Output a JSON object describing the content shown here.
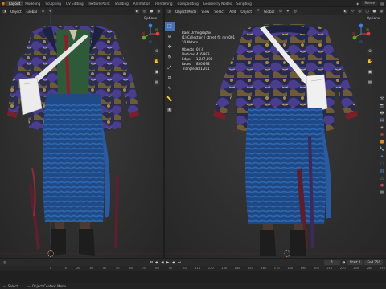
{
  "topbar": {
    "tabs": [
      "Layout",
      "Modeling",
      "Sculpting",
      "UV Editing",
      "Texture Paint",
      "Shading",
      "Animation",
      "Rendering",
      "Compositing",
      "Geometry Nodes",
      "Scripting"
    ],
    "active_tab": "Layout",
    "scene_label": "Scene"
  },
  "left_viewport": {
    "header": [
      "Object",
      "Global"
    ],
    "options_label": "Options"
  },
  "right_viewport": {
    "header": {
      "mode": "Object Mode",
      "menus": [
        "View",
        "Select",
        "Add",
        "Object"
      ],
      "orientation": "Global"
    },
    "options_label": "Options",
    "overlay": {
      "view_name": "Back Orthographic",
      "collection": "(1) Collection | street_fit_mrn001",
      "units": "10 Meters",
      "stats": [
        {
          "label": "Objects",
          "value": "0 / 4"
        },
        {
          "label": "Vertices",
          "value": "416,993"
        },
        {
          "label": "Edges",
          "value": "1,247,890"
        },
        {
          "label": "Faces",
          "value": "830,698"
        },
        {
          "label": "Triangles",
          "value": "831,201"
        }
      ]
    }
  },
  "timeline": {
    "ruler_ticks": [
      "0",
      "10",
      "20",
      "30",
      "40",
      "50",
      "60",
      "70",
      "80",
      "90",
      "100",
      "110",
      "120",
      "130",
      "140",
      "150",
      "160",
      "170",
      "180",
      "190",
      "200",
      "210",
      "220",
      "230",
      "240",
      "250"
    ],
    "current_frame": "1",
    "start_label": "Start",
    "start_value": "1",
    "end_label": "End",
    "end_value": "250"
  },
  "statusbar": {
    "items": [
      "Select",
      "Object Context Menu"
    ]
  },
  "colors": {
    "accent": "#4772b3",
    "brand": "#e87d0d",
    "axis_x": "#e23c4a",
    "axis_y": "#6aa329",
    "axis_z": "#3f7fdd"
  }
}
